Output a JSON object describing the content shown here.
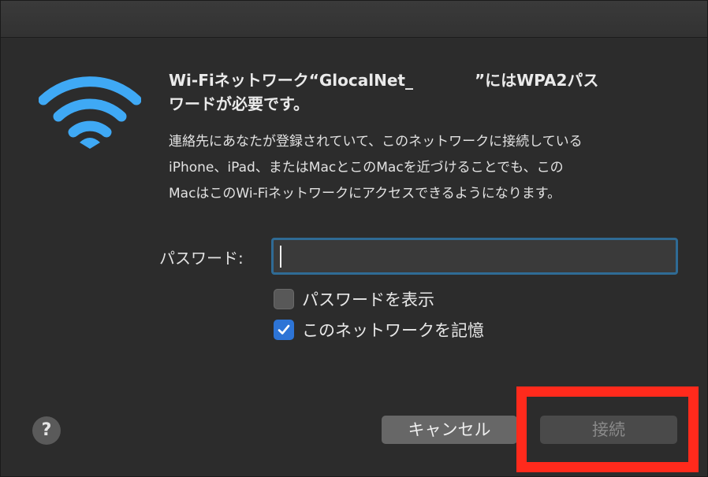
{
  "dialog": {
    "title_line1_prefix": "Wi-Fiネットワーク“GlocalNet_",
    "title_line1_suffix": "”にはWPA2パス",
    "title_line2": "ワードが必要です。",
    "message": "連絡先にあなたが登録されていて、このネットワークに接続している\niPhone、iPad、またはMacとこのMacを近づけることでも、この\nMacはこのWi-Fiネットワークにアクセスできるようになります。"
  },
  "password": {
    "label": "パスワード:",
    "value": ""
  },
  "options": {
    "show_password_label": "パスワードを表示",
    "show_password_checked": false,
    "remember_network_label": "このネットワークを記憶",
    "remember_network_checked": true
  },
  "buttons": {
    "help_label": "?",
    "cancel_label": "キャンセル",
    "connect_label": "接続"
  },
  "icons": {
    "wifi": "wifi-icon",
    "check": "checkmark-icon"
  },
  "colors": {
    "wifi_blue": "#3fa9f5",
    "accent": "#2d74d6",
    "highlight": "#ff2a1c",
    "focus_ring": "#2f6b95"
  }
}
